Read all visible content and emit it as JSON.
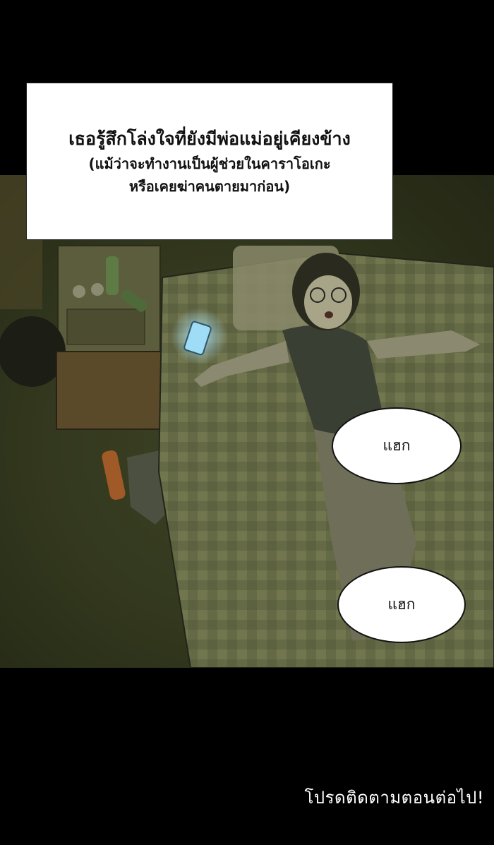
{
  "caption": {
    "line1": "เธอรู้สึกโล่งใจที่ยังมีพ่อแม่อยู่เคียงข้าง",
    "line2": "(แม้ว่าจะทำงานเป็นผู้ช่วยในคาราโอเกะ",
    "line3": "หรือเคยฆ่าคนตายมาก่อน)"
  },
  "bubbles": [
    "แฮก",
    "แฮก"
  ],
  "footer": "โปรดติดตามตอนต่อไป!",
  "colors": {
    "background": "#000000",
    "panel_tone": "#3a4025",
    "bubble_fill": "#ffffff",
    "phone_glow": "#8fd8ff"
  }
}
